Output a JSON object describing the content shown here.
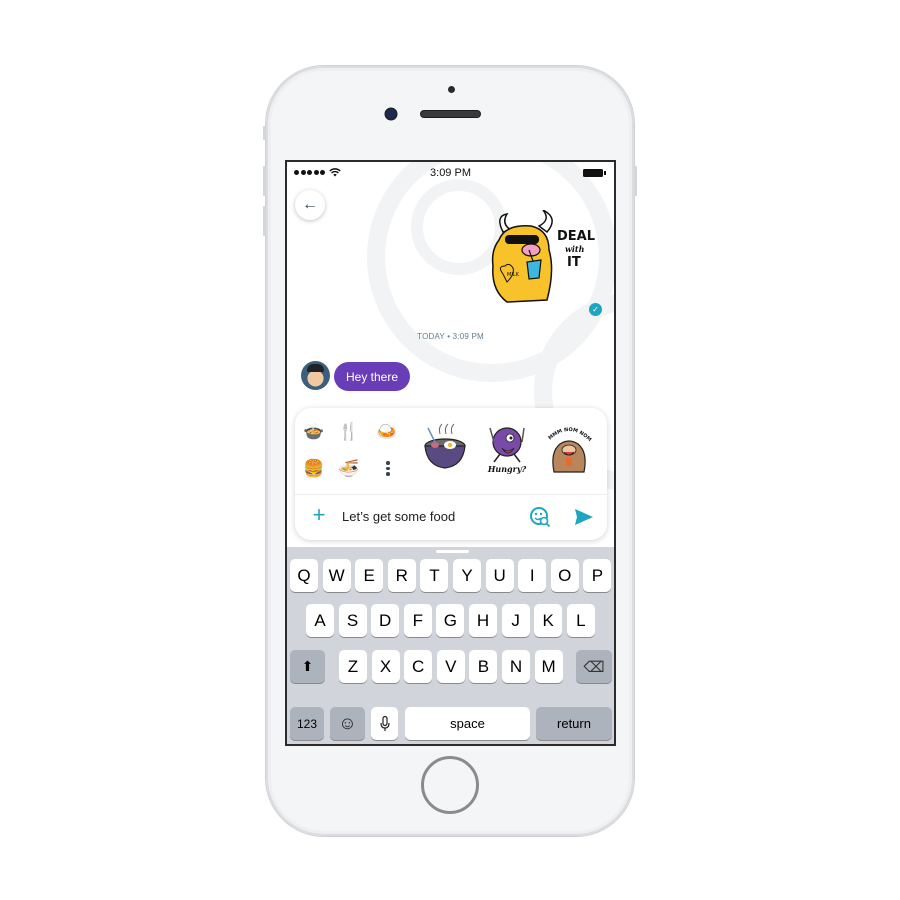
{
  "status_bar": {
    "time": "3:09 PM",
    "wifi_icon": "wifi-icon",
    "battery_icon": "battery-icon"
  },
  "conversation": {
    "back_icon": "arrow-left-icon",
    "back_glyph": "←",
    "sent_sticker": {
      "description": "yellow bull drinking milk sticker",
      "caption_lines": [
        "DEAL",
        "with",
        "IT"
      ],
      "tattoo_text": "MILK"
    },
    "read_receipt_icon": "double-check-icon",
    "timestamp": "TODAY • 3:09 PM",
    "received_message": "Hey there"
  },
  "compose": {
    "emoji_suggestions": [
      {
        "name": "pot-of-food",
        "glyph": "🍲"
      },
      {
        "name": "fork-and-knife",
        "glyph": "🍴"
      },
      {
        "name": "curry-rice",
        "glyph": "🍛"
      },
      {
        "name": "hamburger",
        "glyph": "🍔"
      },
      {
        "name": "steaming-bowl",
        "glyph": "🍜"
      }
    ],
    "more_icon": "more-vertical-icon",
    "sticker_suggestions": [
      {
        "name": "ramen-bowl-sticker",
        "caption": ""
      },
      {
        "name": "hungry-purple-monster-sticker",
        "caption": "Hungry?"
      },
      {
        "name": "mmm-nom-noms-sloth-sticker",
        "caption": "MMM NOM NOMS"
      }
    ],
    "plus_icon": "plus-icon",
    "input_value": "Let’s get some food",
    "sticker_search_icon": "sticker-search-icon",
    "send_icon": "send-icon",
    "accent_color": "#1ea5c0"
  },
  "keyboard": {
    "row1": [
      "Q",
      "W",
      "E",
      "R",
      "T",
      "Y",
      "U",
      "I",
      "O",
      "P"
    ],
    "row2": [
      "A",
      "S",
      "D",
      "F",
      "G",
      "H",
      "J",
      "K",
      "L"
    ],
    "row3": [
      "Z",
      "X",
      "C",
      "V",
      "B",
      "N",
      "M"
    ],
    "shift_glyph": "⬆",
    "delete_glyph": "⌫",
    "numbers_label": "123",
    "emoji_glyph": "☺",
    "mic_glyph": "🎙",
    "space_label": "space",
    "return_label": "return"
  },
  "colors": {
    "bubble_incoming": "#6a3db8",
    "accent": "#1ea5c0",
    "timestamp": "#5f7d8c"
  }
}
